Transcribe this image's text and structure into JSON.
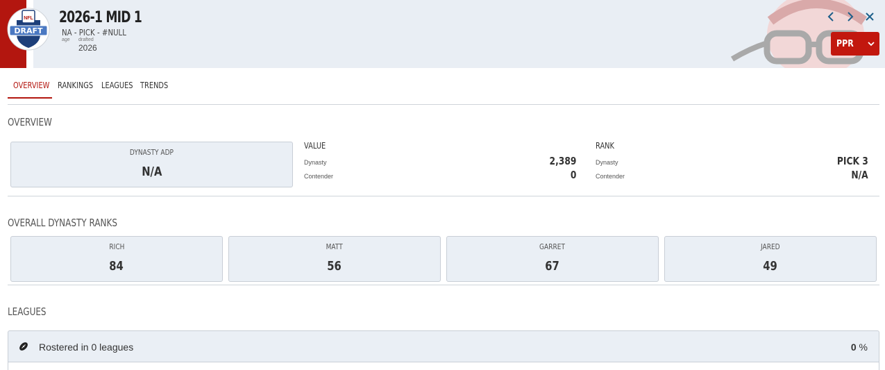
{
  "header": {
    "title": "2026-1 MID 1",
    "subline": "NA - PICK - #NULL",
    "age_label": "age",
    "drafted_label": "drafted",
    "drafted_year": "2026",
    "logo_text": "DRAFT",
    "logo_shield_text": "NFL",
    "format_label": "PPR",
    "icons": [
      "chevron-left-icon",
      "chevron-right-icon",
      "close-icon",
      "chevron-down-icon"
    ]
  },
  "tabs": [
    {
      "label": "OVERVIEW",
      "active": true
    },
    {
      "label": "RANKINGS",
      "active": false
    },
    {
      "label": "LEAGUES",
      "active": false
    },
    {
      "label": "TRENDS",
      "active": false
    }
  ],
  "overview": {
    "title": "OVERVIEW",
    "adp_label": "DYNASTY ADP",
    "adp_value": "N/A",
    "value": {
      "heading": "VALUE",
      "dynasty_label": "Dynasty",
      "dynasty_value": "2,389",
      "contender_label": "Contender",
      "contender_value": "0"
    },
    "rank": {
      "heading": "RANK",
      "dynasty_label": "Dynasty",
      "dynasty_value": "PICK 3",
      "contender_label": "Contender",
      "contender_value": "N/A"
    }
  },
  "dynasty_ranks": {
    "title": "OVERALL DYNASTY RANKS",
    "items": [
      {
        "name": "RICH",
        "value": "84"
      },
      {
        "name": "MATT",
        "value": "56"
      },
      {
        "name": "GARRET",
        "value": "67"
      },
      {
        "name": "JARED",
        "value": "49"
      }
    ]
  },
  "leagues": {
    "title": "LEAGUES",
    "rostered_text": "Rostered in 0 leagues",
    "percent_value": "0",
    "percent_sign": " %"
  },
  "colors": {
    "brand_red": "#b3160f",
    "header_bg": "#e9eef4",
    "card_bg": "#eaeff5"
  }
}
